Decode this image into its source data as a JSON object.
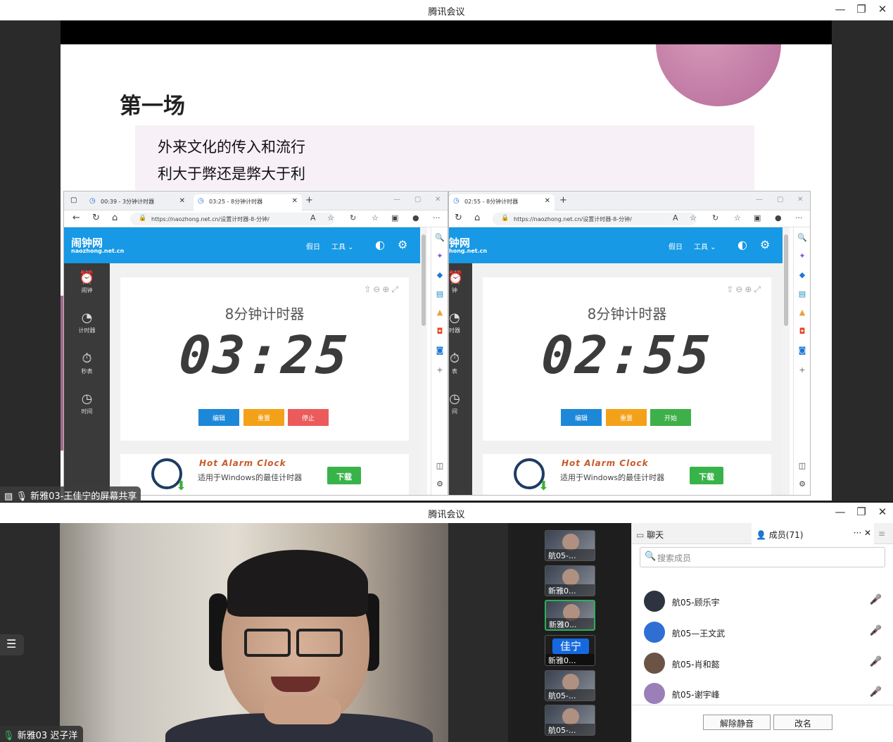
{
  "top_window": {
    "title": "腾讯会议",
    "controls": [
      "—",
      "❐",
      "✕"
    ]
  },
  "slide": {
    "title": "第一场",
    "lines": [
      "外来文化的传入和流行",
      "利大于弊还是弊大于利"
    ]
  },
  "browsers": [
    {
      "tabs": [
        {
          "label": "00:39 - 3分钟计时器",
          "active": false
        },
        {
          "label": "03:25 - 8分钟计时器",
          "active": true
        }
      ],
      "url": "https://naozhong.net.cn/设置计时器-8-分钟/",
      "timer_title": "8分钟计时器",
      "time": "03:25",
      "buttons": [
        {
          "label": "编辑",
          "color": "#1e88d8"
        },
        {
          "label": "重置",
          "color": "#f4a11a"
        },
        {
          "label": "停止",
          "color": "#ec5b5b"
        }
      ]
    },
    {
      "tabs": [
        {
          "label": "02:55 - 8分钟计时器",
          "active": true
        }
      ],
      "url": "https://naozhong.net.cn/设置计时器-8-分钟/",
      "timer_title": "8分钟计时器",
      "time": "02:55",
      "buttons": [
        {
          "label": "编辑",
          "color": "#1e88d8"
        },
        {
          "label": "重置",
          "color": "#f4a11a"
        },
        {
          "label": "开始",
          "color": "#3eb049"
        }
      ]
    }
  ],
  "site": {
    "logo": "闹钟网",
    "logo_sub": "naozhong.net.cn",
    "logo_partial": "钟网",
    "logo_sub_partial": "hong.net.cn",
    "nav": [
      "假日",
      "工具 ⌄"
    ],
    "side_nav": [
      {
        "icon": "alarm-icon",
        "label": "闹钟"
      },
      {
        "icon": "timer-icon",
        "label": "计时器"
      },
      {
        "icon": "stopwatch-icon",
        "label": "秒表"
      },
      {
        "icon": "clock-icon",
        "label": "时间"
      }
    ],
    "side_nav_partial": [
      "钟",
      "时器",
      "表",
      "间"
    ],
    "ad_title": "Hot Alarm Clock",
    "ad_text": "适用于Windows的最佳计时器",
    "ad_button": "下载"
  },
  "share_label": "新雅03-王佳宁的屏幕共享",
  "bottom_window": {
    "title": "腾讯会议",
    "controls": [
      "—",
      "❐",
      "✕"
    ]
  },
  "speaker_label": "新雅03 迟子洋",
  "thumbnails": [
    {
      "name": "航05-..."
    },
    {
      "name": "新雅0..."
    },
    {
      "name": "新雅0..."
    },
    {
      "name": "新雅0...",
      "badge": "佳宁"
    },
    {
      "name": "航05-..."
    },
    {
      "name": "航05-..."
    }
  ],
  "panel": {
    "tab_chat": "聊天",
    "tab_members": "成员(71)",
    "search_placeholder": "搜索成员",
    "members": [
      {
        "name": "航05-顾乐宇",
        "avatar_color": "#2d3340"
      },
      {
        "name": "航05—王文武",
        "avatar_color": "#2f6fd3"
      },
      {
        "name": "航05-肖和懿",
        "avatar_color": "#6b5446"
      },
      {
        "name": "航05-谢宇峰",
        "avatar_color": "#9a7fb8"
      }
    ],
    "unmute_button": "解除静音",
    "rename_button": "改名"
  }
}
